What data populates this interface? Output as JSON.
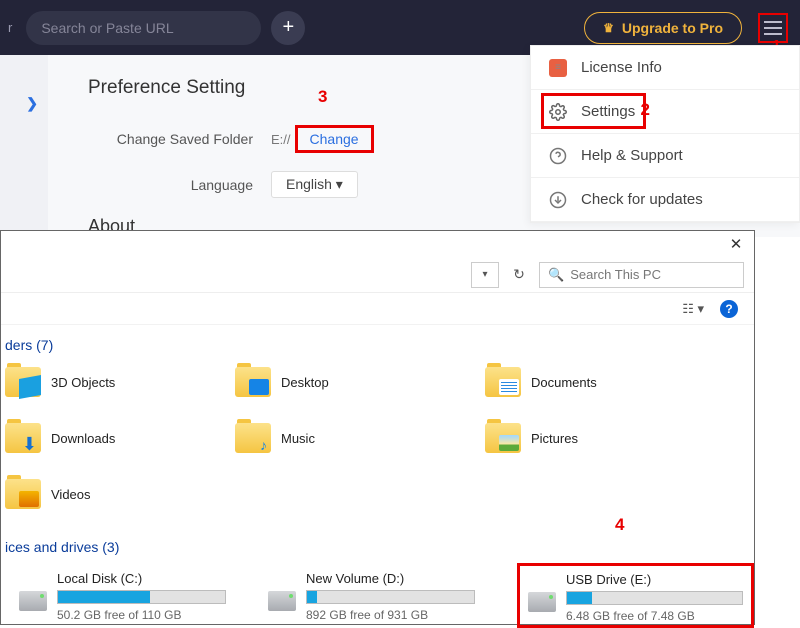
{
  "topbar": {
    "left_letter": "r",
    "search_placeholder": "Search or Paste URL",
    "upgrade_label": "Upgrade to Pro"
  },
  "annotations": {
    "a1": "1",
    "a2": "2",
    "a3": "3",
    "a4": "4"
  },
  "menu": {
    "license": "License Info",
    "settings": "Settings",
    "help": "Help & Support",
    "updates": "Check for updates"
  },
  "pref": {
    "title": "Preference Setting",
    "folder_label": "Change Saved Folder",
    "folder_path": "E://",
    "change": "Change",
    "language_label": "Language",
    "language_value": "English ▾",
    "about": "About"
  },
  "explorer": {
    "search_placeholder": "Search This PC",
    "view_icon": "☷ ▾",
    "folders_header": "ders (7)",
    "folders": {
      "obj3d": "3D Objects",
      "desktop": "Desktop",
      "documents": "Documents",
      "downloads": "Downloads",
      "music": "Music",
      "pictures": "Pictures",
      "videos": "Videos"
    },
    "drives_header": "ices and drives (3)",
    "drives": {
      "c": {
        "name": "Local Disk (C:)",
        "free": "50.2 GB free of 110 GB",
        "fill": "55%"
      },
      "d": {
        "name": "New Volume (D:)",
        "free": "892 GB free of 931 GB",
        "fill": "6%"
      },
      "e": {
        "name": "USB Drive (E:)",
        "free": "6.48 GB free of 7.48 GB",
        "fill": "14%"
      }
    }
  }
}
